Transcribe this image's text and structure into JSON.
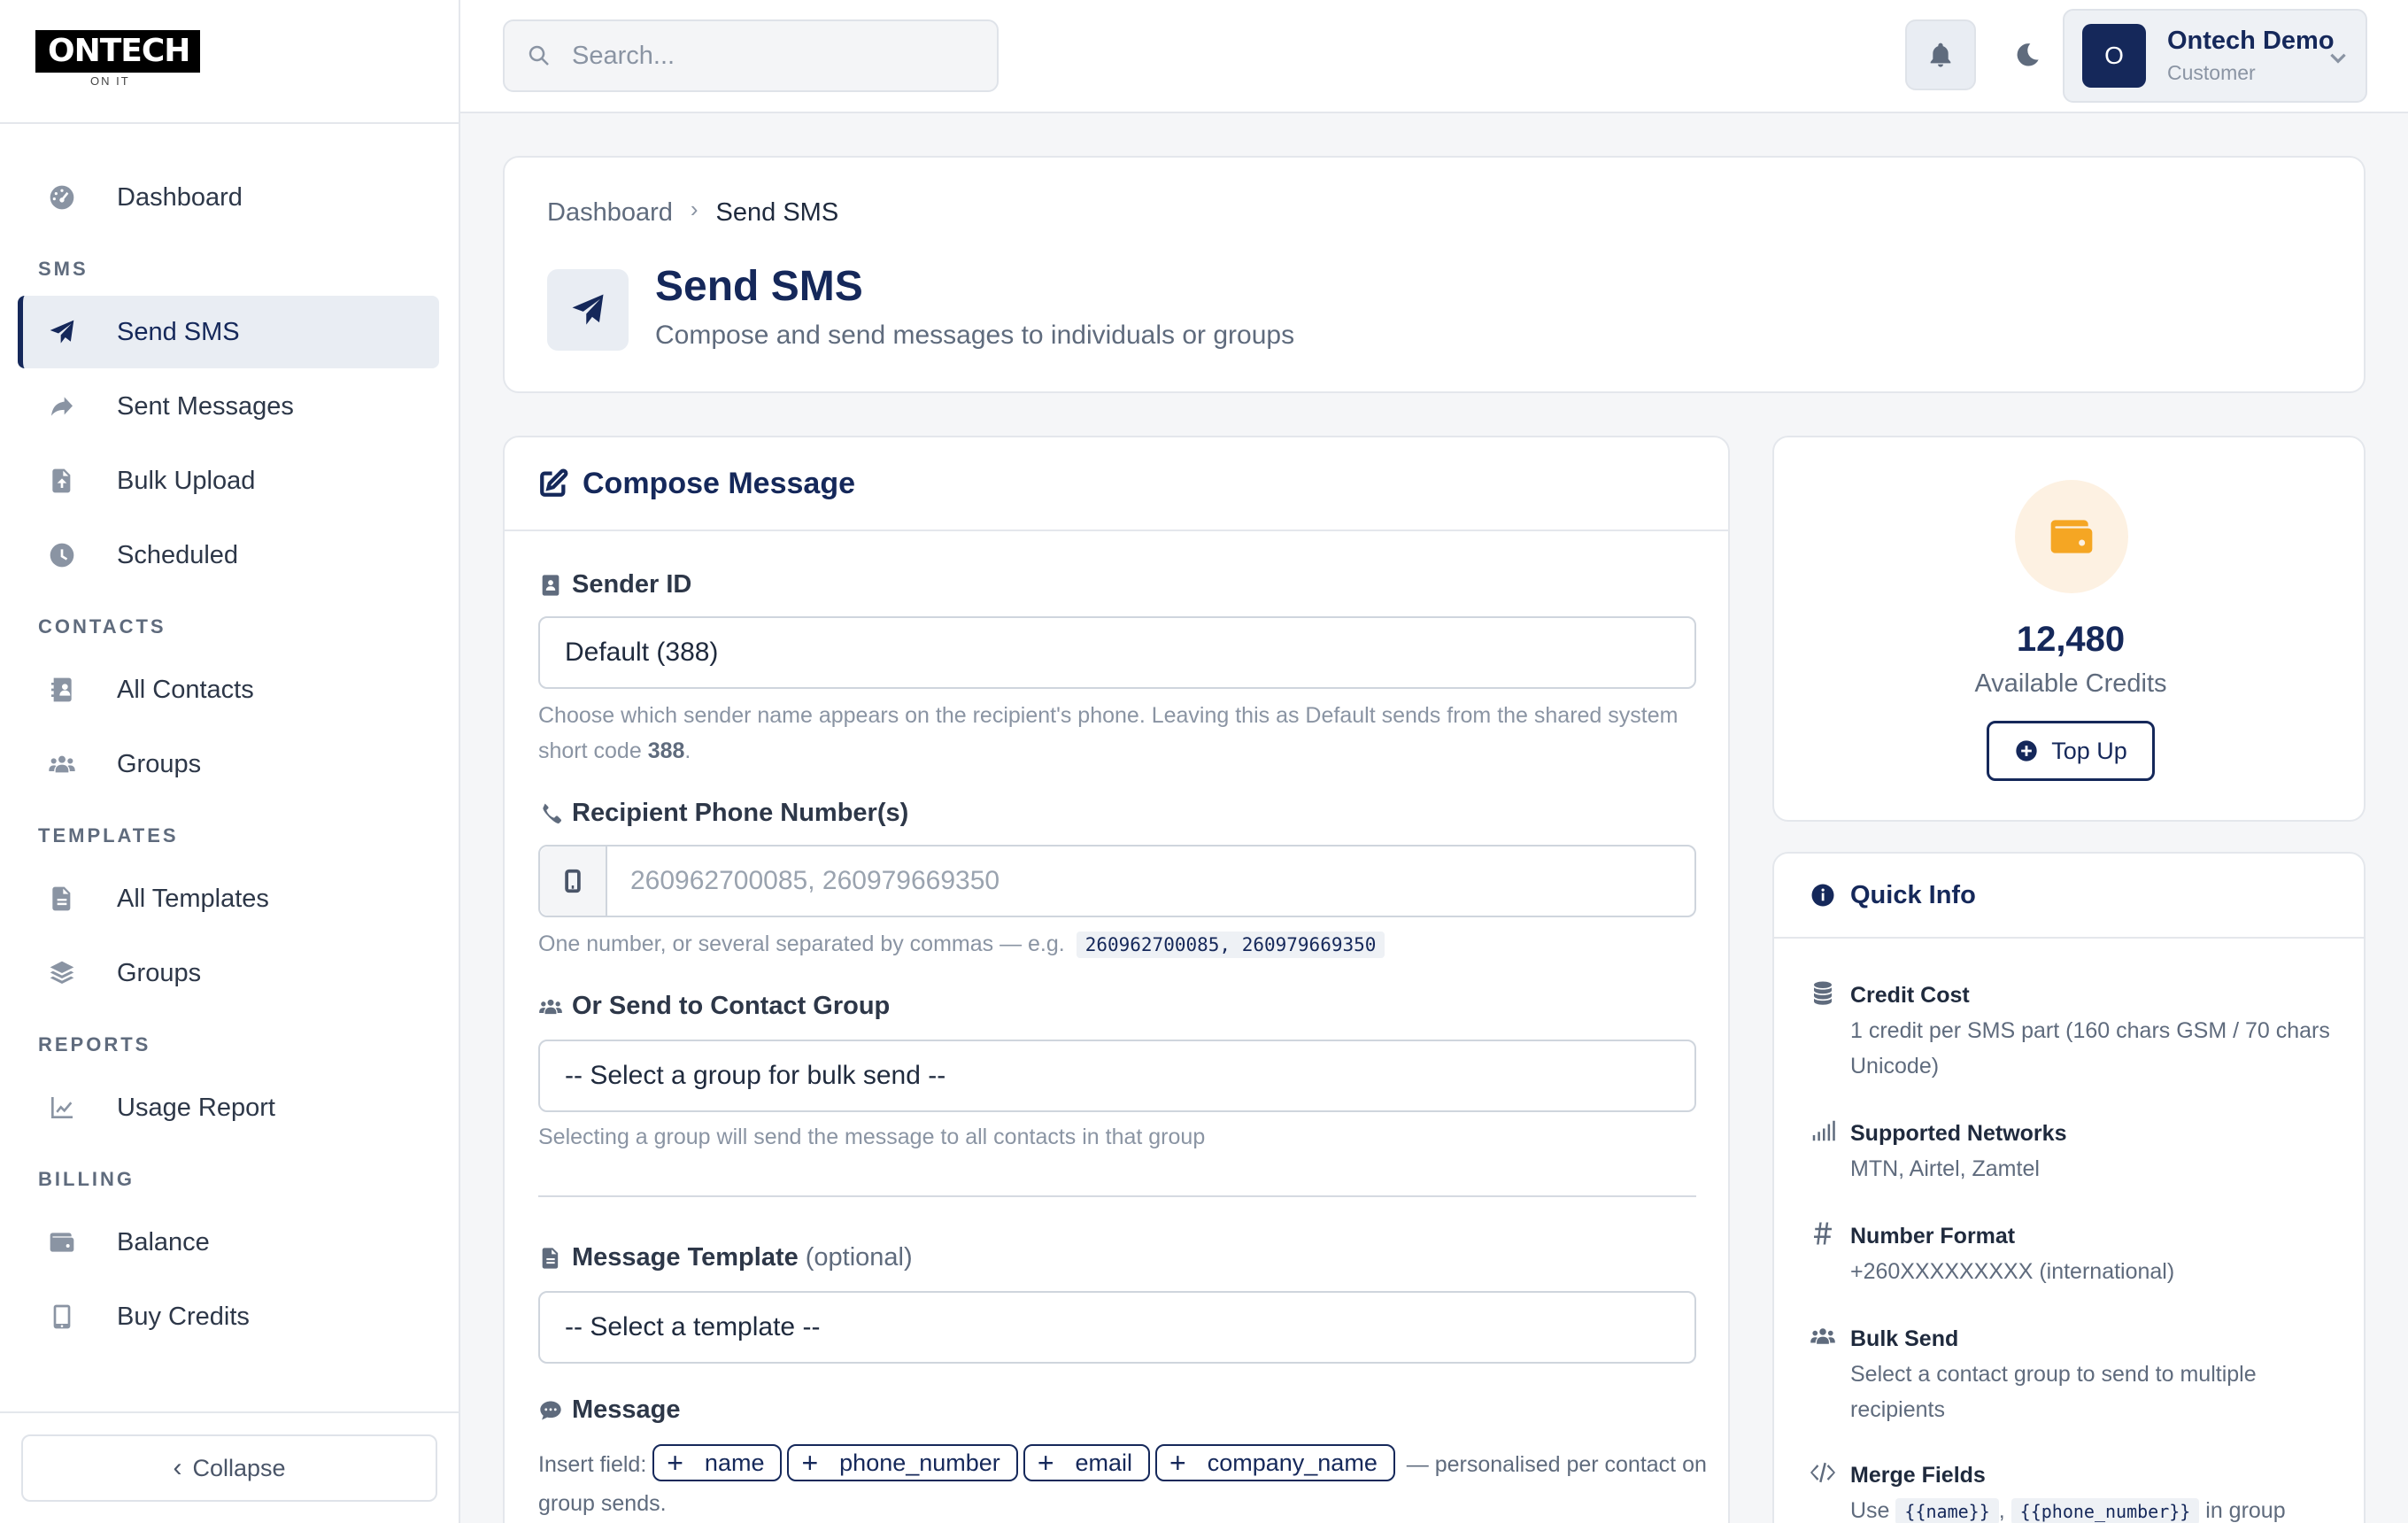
{
  "brand": {
    "name": "ONTECH",
    "tagline": "ON IT"
  },
  "sidebar": {
    "items": [
      {
        "label": "Dashboard"
      }
    ],
    "sections": [
      {
        "title": "SMS",
        "items": [
          {
            "label": "Send SMS"
          },
          {
            "label": "Sent Messages"
          },
          {
            "label": "Bulk Upload"
          },
          {
            "label": "Scheduled"
          }
        ]
      },
      {
        "title": "CONTACTS",
        "items": [
          {
            "label": "All Contacts"
          },
          {
            "label": "Groups"
          }
        ]
      },
      {
        "title": "TEMPLATES",
        "items": [
          {
            "label": "All Templates"
          },
          {
            "label": "Groups"
          }
        ]
      },
      {
        "title": "REPORTS",
        "items": [
          {
            "label": "Usage Report"
          }
        ]
      },
      {
        "title": "BILLING",
        "items": [
          {
            "label": "Balance"
          },
          {
            "label": "Buy Credits"
          }
        ]
      }
    ],
    "collapse_label": "Collapse"
  },
  "topbar": {
    "search_placeholder": "Search...",
    "user": {
      "initial": "O",
      "name": "Ontech Demo",
      "role": "Customer"
    }
  },
  "header": {
    "breadcrumb": {
      "parent": "Dashboard",
      "current": "Send SMS"
    },
    "title": "Send SMS",
    "subtitle": "Compose and send messages to individuals or groups"
  },
  "compose": {
    "title": "Compose Message",
    "sender": {
      "label": "Sender ID",
      "value": "Default (388)",
      "help_text": "Choose which sender name appears on the recipient's phone. Leaving this as Default sends from the shared system short code ",
      "help_code": "388",
      "help_end": "."
    },
    "recipient": {
      "label": "Recipient Phone Number(s)",
      "placeholder": "260962700085, 260979669350",
      "help_text": "One number, or several separated by commas — e.g.",
      "help_example": "260962700085, 260979669350"
    },
    "group": {
      "label": "Or Send to Contact Group",
      "value": "-- Select a group for bulk send --",
      "help_text": "Selecting a group will send the message to all contacts in that group"
    },
    "template": {
      "label": "Message Template",
      "optional": "(optional)",
      "value": "-- Select a template --"
    },
    "message": {
      "label": "Message",
      "insert_label": "Insert field:",
      "fields": [
        "name",
        "phone_number",
        "email",
        "company_name"
      ],
      "insert_suffix": "— personalised per contact on group sends."
    }
  },
  "credits": {
    "amount": "12,480",
    "label": "Available Credits",
    "topup_label": "Top Up",
    "accent_color": "#f5a623"
  },
  "quick_info": {
    "title": "Quick Info",
    "items": [
      {
        "title": "Credit Cost",
        "text": "1 credit per SMS part (160 chars GSM / 70 chars Unicode)"
      },
      {
        "title": "Supported Networks",
        "text": "MTN, Airtel, Zamtel"
      },
      {
        "title": "Number Format",
        "text": "+260XXXXXXXXX (international)"
      },
      {
        "title": "Bulk Send",
        "text": "Select a contact group to send to multiple recipients"
      },
      {
        "title": "Merge Fields",
        "text_pre": "Use",
        "code1": "{{name}}",
        "sep": ",",
        "code2": "{{phone_number}}",
        "text_post": "in group"
      }
    ]
  }
}
